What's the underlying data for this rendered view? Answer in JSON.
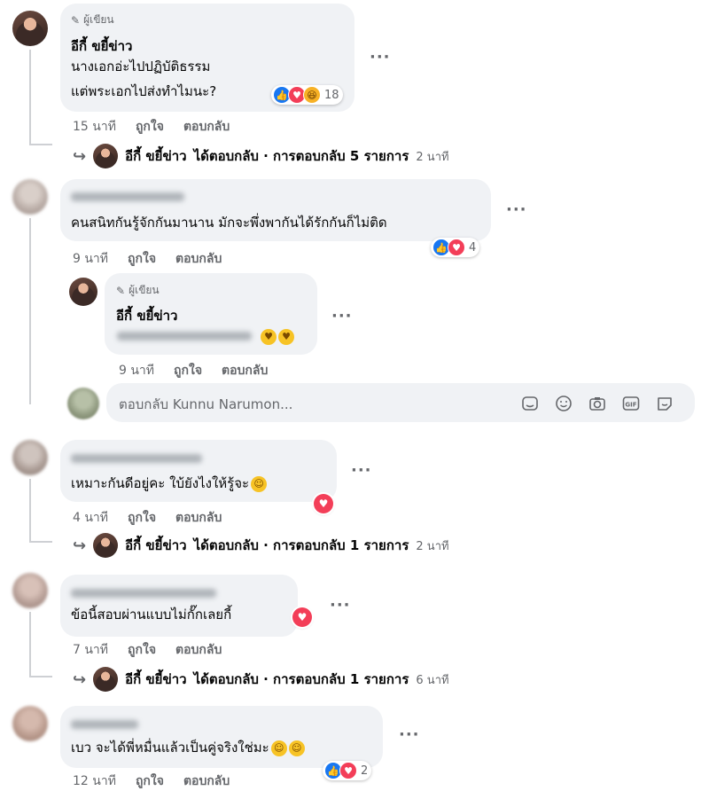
{
  "comments": [
    {
      "author_badge": "ผู้เขียน",
      "author_name": "อีกี้ ขยี้ข่าว",
      "lines": [
        "นางเอกอ่ะไปปฏิบัติธรรม",
        "แต่พระเอกไปส่งทำไมนะ?"
      ],
      "reaction_count": "18",
      "time": "15 นาที",
      "like": "ถูกใจ",
      "reply": "ตอบกลับ",
      "replies_summary": {
        "name": "อีกี้ ขยี้ข่าว",
        "text": "ได้ตอบกลับ · การตอบกลับ 5 รายการ",
        "time": "2 นาที"
      }
    },
    {
      "text": "คนสนิทกันรู้จักกันมานาน มักจะพึ่งพากันได้รักกันก็ไม่ติด",
      "reaction_count": "4",
      "time": "9 นาที",
      "like": "ถูกใจ",
      "reply": "ตอบกลับ",
      "author_reply": {
        "author_badge": "ผู้เขียน",
        "author_name": "อีกี้ ขยี้ข่าว",
        "time": "9 นาที",
        "like": "ถูกใจ",
        "reply": "ตอบกลับ"
      },
      "reply_input_placeholder": "ตอบกลับ Kunnu Narumon..."
    },
    {
      "text": "เหมาะกันดีอยู่คะ ใบ้ยังไงให้รู้จะ",
      "time": "4 นาที",
      "like": "ถูกใจ",
      "reply": "ตอบกลับ",
      "replies_summary": {
        "name": "อีกี้ ขยี้ข่าว",
        "text": "ได้ตอบกลับ · การตอบกลับ 1 รายการ",
        "time": "2 นาที"
      }
    },
    {
      "text": "ข้อนี้สอบผ่านแบบไม่กั๊กเลยกี้",
      "time": "7 นาที",
      "like": "ถูกใจ",
      "reply": "ตอบกลับ",
      "replies_summary": {
        "name": "อีกี้ ขยี้ข่าว",
        "text": "ได้ตอบกลับ · การตอบกลับ 1 รายการ",
        "time": "6 นาที"
      }
    },
    {
      "text": "เบว จะได้พี่หมื่นแล้วเป็นคู่จริงใช่มะ",
      "reaction_count": "2",
      "time": "12 นาที",
      "like": "ถูกใจ",
      "reply": "ตอบกลับ"
    }
  ],
  "icons": {
    "more": "more-options-icon",
    "reply_arrow": "reply-arrow-icon",
    "sticker": "sticker-icon",
    "emoji": "emoji-icon",
    "camera": "camera-icon",
    "gif": "gif-icon",
    "avatar_sticker": "avatar-sticker-icon"
  },
  "colors": {
    "like": "#1877f2",
    "love": "#f33e58",
    "haha": "#f7b125",
    "bubble": "#f0f2f5",
    "meta": "#65676b"
  }
}
